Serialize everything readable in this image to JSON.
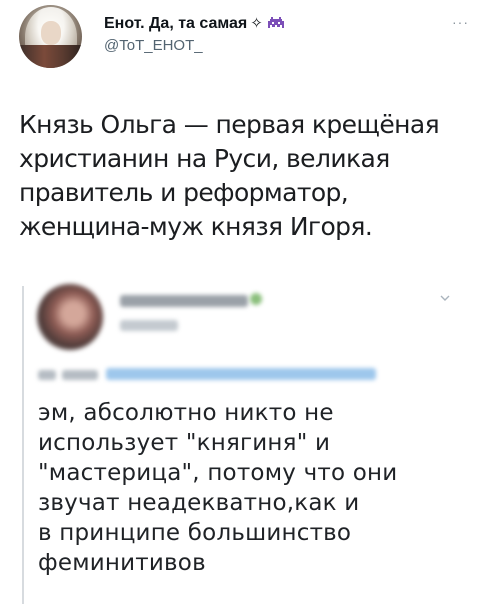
{
  "author": {
    "name": "Енот. Да, та самая",
    "sparkle": "✧",
    "handle": "@ToT_EHOT_"
  },
  "menu": {
    "more": "···"
  },
  "tweet": {
    "lines": [
      "Князь Ольга — первая крещёная",
      "христианин на Руси, великая",
      "правитель и реформатор,",
      "женщина-муж князя Игоря."
    ]
  },
  "quoted": {
    "lines": [
      "эм, абсолютно никто не",
      "использует \"княгиня\" и",
      "\"мастерица\", потому что они",
      "звучат неадекватно,как и",
      "в принципе большинство",
      "феминитивов"
    ]
  },
  "colors": {
    "text": "#0f1419",
    "secondary": "#536471",
    "divider": "#d7dbdf",
    "link_blur": "#9ec7ec"
  }
}
